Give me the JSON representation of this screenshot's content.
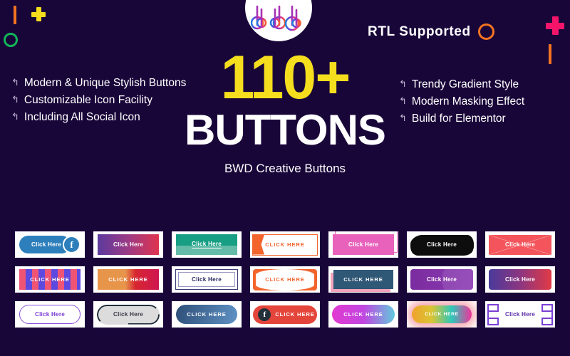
{
  "background_color": "#190639",
  "logo": {
    "name": "bdb-logo",
    "alt": "bdb"
  },
  "rtl": {
    "label": "RTL  Supported",
    "icon": "circle-outline-icon",
    "icon_color": "#f47321"
  },
  "decorations": [
    {
      "name": "bar-orange-top-left",
      "color": "#f47321"
    },
    {
      "name": "plus-yellow-top-left",
      "color": "#f5dd1e"
    },
    {
      "name": "circle-green-top-left",
      "color": "#10b759"
    },
    {
      "name": "plus-pink-top-right",
      "color": "#f4156b"
    },
    {
      "name": "bar-orange-top-right",
      "color": "#f47321"
    }
  ],
  "features_left": [
    "Modern & Unique Stylish Buttons",
    "Customizable Icon Facility",
    "Including All Social Icon"
  ],
  "features_right": [
    "Trendy Gradient Style",
    "Modern Masking Effect",
    "Build for Elementor"
  ],
  "bullet_glyph": "↰",
  "hero": {
    "count": "110+",
    "count_color": "#f5de1d",
    "title": "BUTTONS",
    "subtitle": "BWD Creative Buttons"
  },
  "buttons": [
    {
      "name": "button-facebook-pill",
      "label": "Click Here",
      "icon": "facebook-icon",
      "icon_glyph": "f"
    },
    {
      "name": "button-purple-red-gradient",
      "label": "Click Here"
    },
    {
      "name": "button-teal-underline",
      "label": "Click Here"
    },
    {
      "name": "button-orange-chevron",
      "label": "CLICK HERE"
    },
    {
      "name": "button-pink-offset-outline",
      "label": "Click Here"
    },
    {
      "name": "button-black-brush",
      "label": "Click Here"
    },
    {
      "name": "button-red-crosslines",
      "label": "Click Here"
    },
    {
      "name": "button-striped",
      "label": "CLICK HERE"
    },
    {
      "name": "button-orange-crimson",
      "label": "CLICK HERE"
    },
    {
      "name": "button-navy-inner-border",
      "label": "Click Here"
    },
    {
      "name": "button-orange-curved-sides",
      "label": "CLICK HERE"
    },
    {
      "name": "button-slate-pink-shadow",
      "label": "CLICK HERE"
    },
    {
      "name": "button-purple-masked",
      "label": "Click Here"
    },
    {
      "name": "button-purple-red-rounded",
      "label": "Click Here"
    },
    {
      "name": "button-purple-outline-pill",
      "label": "Click Here"
    },
    {
      "name": "button-grey-ring-pill",
      "label": "Click Here"
    },
    {
      "name": "button-blue-gradient-pill",
      "label": "CLICK HERE"
    },
    {
      "name": "button-red-facebook-pill",
      "label": "CLICK HERE",
      "icon": "facebook-icon",
      "icon_glyph": "f"
    },
    {
      "name": "button-magenta-cyan-pill",
      "label": "CLICK HERE"
    },
    {
      "name": "button-glow-gradient-pill",
      "label": "CLICK HERE"
    },
    {
      "name": "button-bracket-corners",
      "label": "Click Here"
    }
  ]
}
